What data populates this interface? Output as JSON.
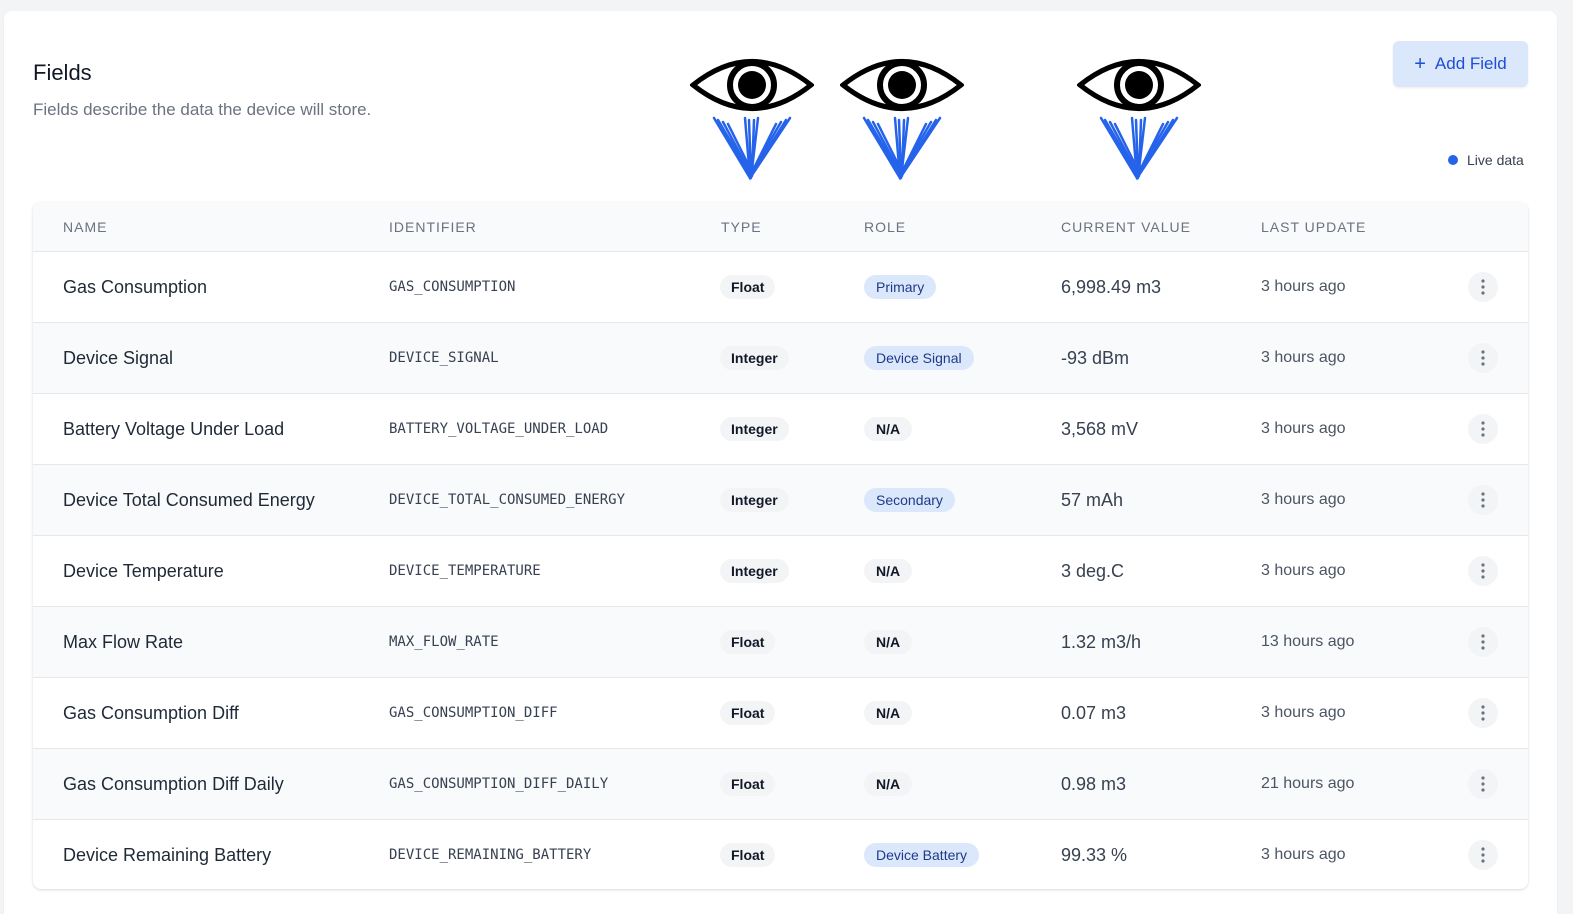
{
  "header": {
    "title": "Fields",
    "subtitle": "Fields describe the data the device will store.",
    "add_button_icon": "plus-icon",
    "add_button_label": "Add Field",
    "live_indicator_label": "Live data"
  },
  "colors": {
    "accent": "#2563eb",
    "button_bg": "#dbe7fb",
    "role_blue_bg": "#dbe7fb",
    "role_blue_text": "#1e3a8a",
    "eye_stroke": "#000000",
    "arrow_stroke": "#2563eb"
  },
  "decorations": [
    "eye-arrow-icon",
    "eye-arrow-icon",
    "eye-arrow-icon"
  ],
  "table": {
    "columns": [
      "NAME",
      "IDENTIFIER",
      "TYPE",
      "ROLE",
      "CURRENT VALUE",
      "LAST UPDATE"
    ],
    "rows": [
      {
        "name": "Gas Consumption",
        "identifier": "GAS_CONSUMPTION",
        "type": "Float",
        "role": "Primary",
        "role_style": "blue",
        "value": "6,998.49 m3",
        "updated": "3 hours ago"
      },
      {
        "name": "Device Signal",
        "identifier": "DEVICE_SIGNAL",
        "type": "Integer",
        "role": "Device Signal",
        "role_style": "blue",
        "value": "-93 dBm",
        "updated": "3 hours ago"
      },
      {
        "name": "Battery Voltage Under Load",
        "identifier": "BATTERY_VOLTAGE_UNDER_LOAD",
        "type": "Integer",
        "role": "N/A",
        "role_style": "gray",
        "value": "3,568 mV",
        "updated": "3 hours ago"
      },
      {
        "name": "Device Total Consumed Energy",
        "identifier": "DEVICE_TOTAL_CONSUMED_ENERGY",
        "type": "Integer",
        "role": "Secondary",
        "role_style": "blue",
        "value": "57 mAh",
        "updated": "3 hours ago"
      },
      {
        "name": "Device Temperature",
        "identifier": "DEVICE_TEMPERATURE",
        "type": "Integer",
        "role": "N/A",
        "role_style": "gray",
        "value": "3 deg.C",
        "updated": "3 hours ago"
      },
      {
        "name": "Max Flow Rate",
        "identifier": "MAX_FLOW_RATE",
        "type": "Float",
        "role": "N/A",
        "role_style": "gray",
        "value": "1.32 m3/h",
        "updated": "13 hours ago"
      },
      {
        "name": "Gas Consumption Diff",
        "identifier": "GAS_CONSUMPTION_DIFF",
        "type": "Float",
        "role": "N/A",
        "role_style": "gray",
        "value": "0.07 m3",
        "updated": "3 hours ago"
      },
      {
        "name": "Gas Consumption Diff Daily",
        "identifier": "GAS_CONSUMPTION_DIFF_DAILY",
        "type": "Float",
        "role": "N/A",
        "role_style": "gray",
        "value": "0.98 m3",
        "updated": "21 hours ago"
      },
      {
        "name": "Device Remaining Battery",
        "identifier": "DEVICE_REMAINING_BATTERY",
        "type": "Float",
        "role": "Device Battery",
        "role_style": "blue",
        "value": "99.33 %",
        "updated": "3 hours ago"
      }
    ],
    "row_menu_icon": "more-vertical-icon"
  }
}
